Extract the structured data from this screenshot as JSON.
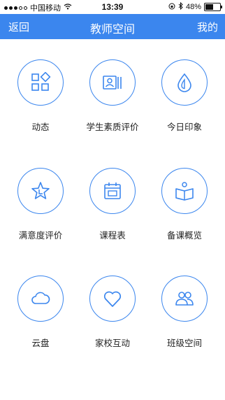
{
  "status_bar": {
    "carrier": "中国移动",
    "time": "13:39",
    "battery": "48%",
    "battery_level": 0.48
  },
  "nav": {
    "back": "返回",
    "title": "教师空间",
    "right": "我的"
  },
  "colors": {
    "accent": "#3b86ee",
    "text": "#222222"
  },
  "items": [
    {
      "label": "动态",
      "icon": "dashboard-grid-icon"
    },
    {
      "label": "学生素质评价",
      "icon": "student-card-icon"
    },
    {
      "label": "今日印象",
      "icon": "drop-icon"
    },
    {
      "label": "满意度评价",
      "icon": "star-icon"
    },
    {
      "label": "课程表",
      "icon": "calendar-icon"
    },
    {
      "label": "备课概览",
      "icon": "reading-book-icon"
    },
    {
      "label": "云盘",
      "icon": "cloud-icon"
    },
    {
      "label": "家校互动",
      "icon": "heart-icon"
    },
    {
      "label": "班级空间",
      "icon": "people-icon"
    }
  ]
}
